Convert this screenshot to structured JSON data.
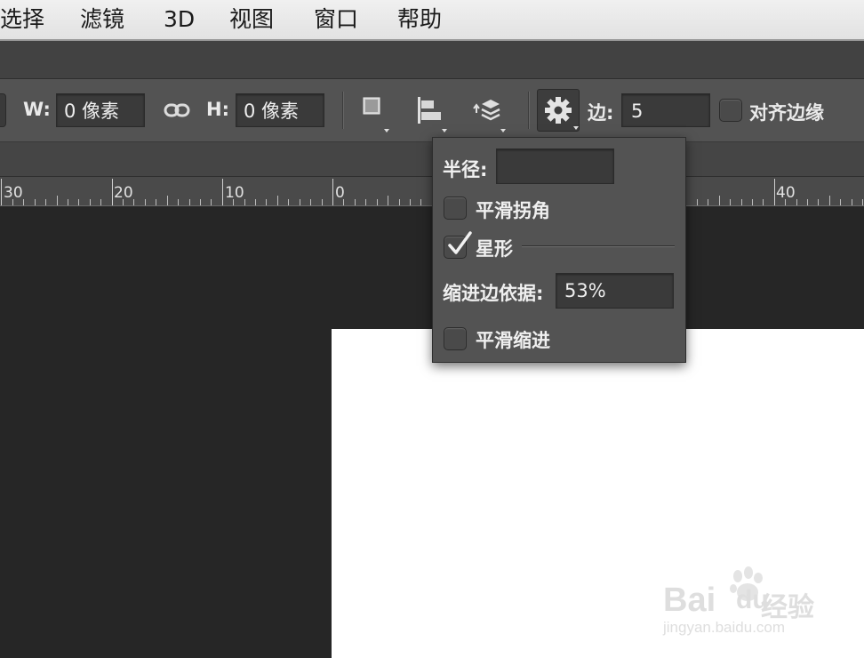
{
  "menu": [
    "选择",
    "滤镜",
    "3D",
    "视图",
    "窗口",
    "帮助"
  ],
  "options_bar": {
    "width_label": "W:",
    "width_value": "0 像素",
    "height_label": "H:",
    "height_value": "0 像素",
    "sides_label": "边:",
    "sides_value": "5",
    "align_edges_label": "对齐边缘"
  },
  "ruler": {
    "labels": [
      "30",
      "20",
      "10",
      "0",
      "40"
    ]
  },
  "popup": {
    "radius_label": "半径:",
    "radius_value": "",
    "smooth_corners_label": "平滑拐角",
    "smooth_corners_checked": false,
    "star_label": "星形",
    "star_checked": true,
    "indent_label": "缩进边依据:",
    "indent_value": "53%",
    "smooth_indents_label": "平滑缩进",
    "smooth_indents_checked": false
  },
  "watermark": {
    "brand": "Bai",
    "brand2": "du",
    "product": "经验",
    "url": "jingyan.baidu.com"
  }
}
